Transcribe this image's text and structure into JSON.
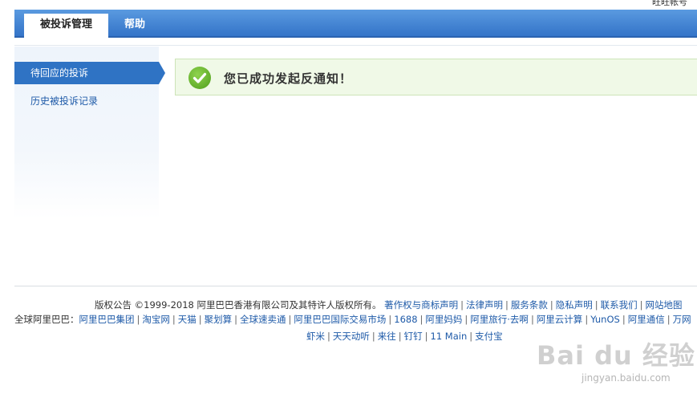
{
  "top_link": "旺旺帐号",
  "tabs": [
    {
      "label": "被投诉管理"
    },
    {
      "label": "帮助"
    }
  ],
  "sidebar": {
    "items": [
      {
        "label": "待回应的投诉"
      },
      {
        "label": "历史被投诉记录"
      }
    ]
  },
  "success": {
    "message": "您已成功发起反通知！"
  },
  "footer": {
    "copyright": "版权公告 ©1999-2018 阿里巴巴香港有限公司及其特许人版权所有。",
    "legal_links": [
      "著作权与商标声明",
      "法律声明",
      "服务条款",
      "隐私声明",
      "联系我们",
      "网站地图"
    ],
    "group_prefix": "全球阿里巴巴：",
    "group_links": [
      "阿里巴巴集团",
      "淘宝网",
      "天猫",
      "聚划算",
      "全球速卖通",
      "阿里巴巴国际交易市场",
      "1688",
      "阿里妈妈",
      "阿里旅行·去啊",
      "阿里云计算",
      "YunOS",
      "阿里通信",
      "万网"
    ],
    "group_links_row3": [
      "虾米",
      "天天动听",
      "来往",
      "钉钉",
      "11 Main",
      "支付宝"
    ]
  },
  "watermark": {
    "brand": "Bai du 经验",
    "url": "jingyan.baidu.com"
  }
}
